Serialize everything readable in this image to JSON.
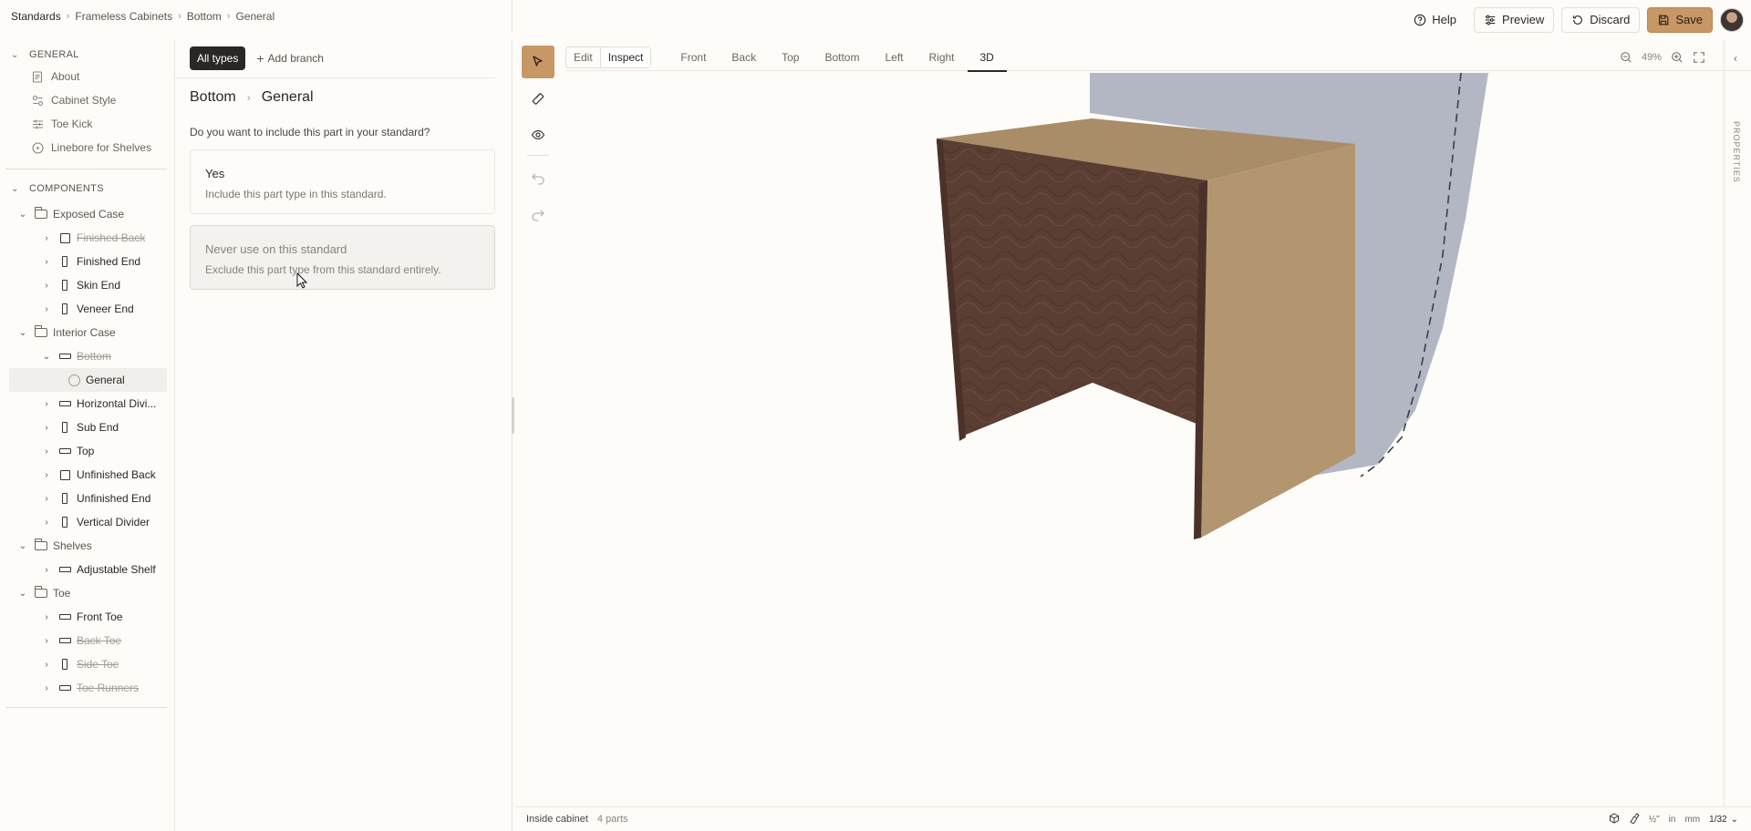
{
  "breadcrumb": [
    "Standards",
    "Frameless Cabinets",
    "Bottom",
    "General"
  ],
  "actions": {
    "help": "Help",
    "preview": "Preview",
    "discard": "Discard",
    "save": "Save"
  },
  "sidebar": {
    "general_header": "GENERAL",
    "general_items": [
      {
        "label": "About",
        "icon": "document-icon"
      },
      {
        "label": "Cabinet Style",
        "icon": "style-icon"
      },
      {
        "label": "Toe Kick",
        "icon": "sliders-icon"
      },
      {
        "label": "Linebore for Shelves",
        "icon": "circle-dot-icon"
      }
    ],
    "components_header": "COMPONENTS",
    "tree": [
      {
        "label": "Exposed Case",
        "level": 0,
        "type": "folder"
      },
      {
        "label": "Finished Back",
        "level": 1,
        "type": "square",
        "strike": true
      },
      {
        "label": "Finished End",
        "level": 1,
        "type": "vertical"
      },
      {
        "label": "Skin End",
        "level": 1,
        "type": "vertical"
      },
      {
        "label": "Veneer End",
        "level": 1,
        "type": "vertical"
      },
      {
        "label": "Interior Case",
        "level": 0,
        "type": "folder"
      },
      {
        "label": "Bottom",
        "level": 1,
        "type": "horizontal",
        "strike": true,
        "expanded": true
      },
      {
        "label": "General",
        "level": 2,
        "type": "circle",
        "selected": true
      },
      {
        "label": "Horizontal Divi...",
        "level": 1,
        "type": "horizontal"
      },
      {
        "label": "Sub End",
        "level": 1,
        "type": "vertical"
      },
      {
        "label": "Top",
        "level": 1,
        "type": "horizontal"
      },
      {
        "label": "Unfinished Back",
        "level": 1,
        "type": "square"
      },
      {
        "label": "Unfinished End",
        "level": 1,
        "type": "vertical"
      },
      {
        "label": "Vertical Divider",
        "level": 1,
        "type": "vertical"
      },
      {
        "label": "Shelves",
        "level": 0,
        "type": "folder"
      },
      {
        "label": "Adjustable Shelf",
        "level": 1,
        "type": "horizontal"
      },
      {
        "label": "Toe",
        "level": 0,
        "type": "folder"
      },
      {
        "label": "Front Toe",
        "level": 1,
        "type": "horizontal"
      },
      {
        "label": "Back Toe",
        "level": 1,
        "type": "horizontal",
        "strike": true
      },
      {
        "label": "Side Toe",
        "level": 1,
        "type": "vertical",
        "strike": true
      },
      {
        "label": "Toe Runners",
        "level": 1,
        "type": "horizontal",
        "strike": true
      }
    ]
  },
  "middle": {
    "all_types": "All types",
    "add_branch": "Add branch",
    "crumb": [
      "Bottom",
      "General"
    ],
    "question": "Do you want to include this part in your standard?",
    "options": [
      {
        "title": "Yes",
        "description": "Include this part type in this standard."
      },
      {
        "title": "Never use on this standard",
        "description": "Exclude this part type from this standard entirely."
      }
    ]
  },
  "viewer": {
    "modes": [
      "Edit",
      "Inspect"
    ],
    "active_mode": "Inspect",
    "tabs": [
      "Front",
      "Back",
      "Top",
      "Bottom",
      "Left",
      "Right",
      "3D"
    ],
    "active_tab": "3D",
    "zoom": "49%",
    "properties": "PROPERTIES"
  },
  "status": {
    "label": "Inside cabinet",
    "parts": "4 parts",
    "unit_fraction": "½\"",
    "unit_in": "in",
    "unit_mm": "mm",
    "precision": "1/32"
  },
  "colors": {
    "accent": "#c89766",
    "wood_dark": "#5a3d33",
    "wood_light": "#b39670",
    "wall": "#b3b7c3"
  }
}
